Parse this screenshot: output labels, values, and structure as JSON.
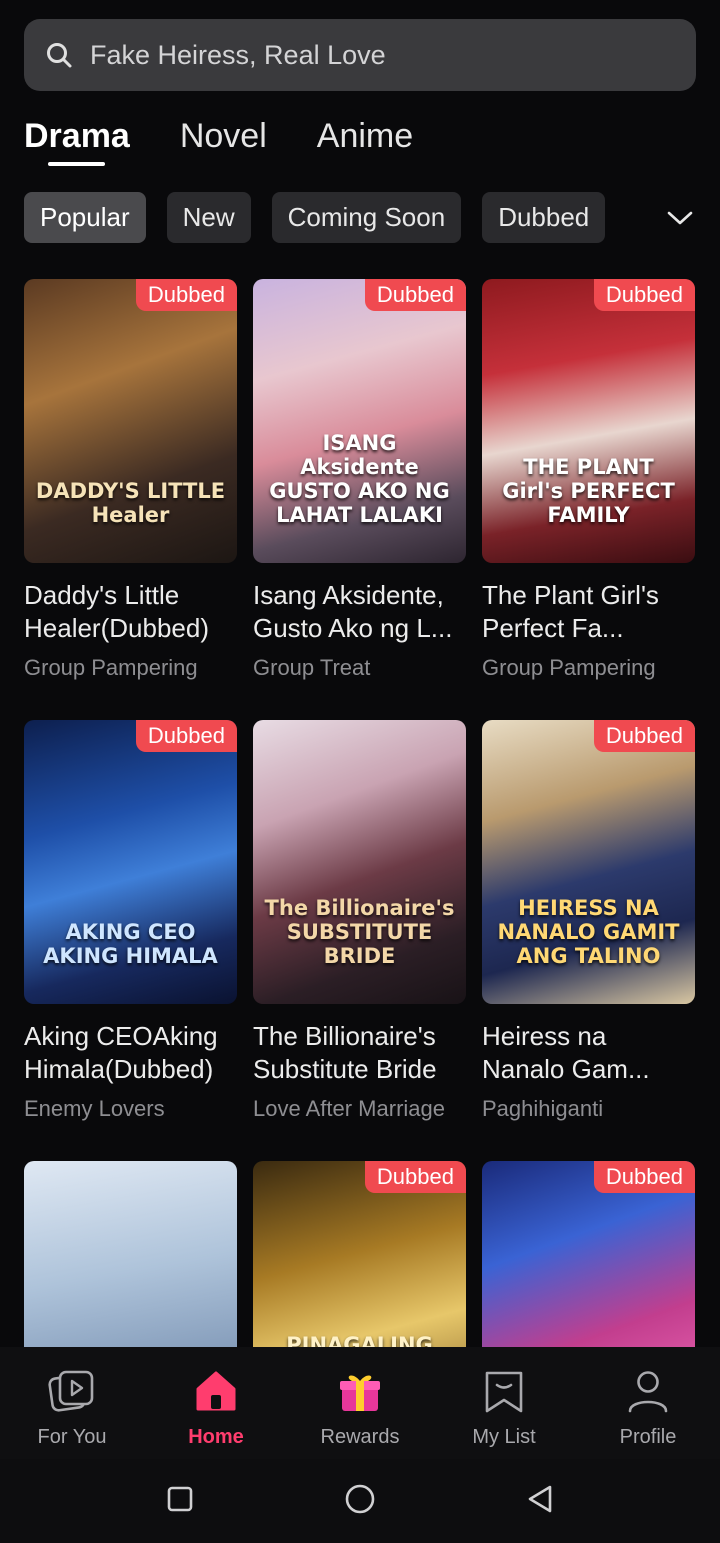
{
  "search": {
    "placeholder": "Fake Heiress, Real Love",
    "icon": "search-icon"
  },
  "tabs": [
    {
      "label": "Drama",
      "active": true
    },
    {
      "label": "Novel",
      "active": false
    },
    {
      "label": "Anime",
      "active": false
    }
  ],
  "chips": [
    {
      "label": "Popular",
      "active": true
    },
    {
      "label": "New",
      "active": false
    },
    {
      "label": "Coming Soon",
      "active": false
    },
    {
      "label": "Dubbed",
      "active": false
    }
  ],
  "chip_expand_icon": "chevron-down-icon",
  "cards": [
    {
      "title": "Daddy's Little Healer(Dubbed)",
      "genre": "Group Pampering",
      "badge": "Dubbed",
      "poster_text": "DADDY'S LITTLE Healer"
    },
    {
      "title": "Isang Aksidente, Gusto Ako ng L...",
      "genre": "Group Treat",
      "badge": "Dubbed",
      "poster_text": "ISANG Aksidente GUSTO AKO NG LAHAT LALAKI"
    },
    {
      "title": "The Plant Girl's Perfect Fa...",
      "genre": "Group Pampering",
      "badge": "Dubbed",
      "poster_text": "THE PLANT Girl's PERFECT FAMILY"
    },
    {
      "title": "Aking CEOAking Himala(Dubbed)",
      "genre": "Enemy Lovers",
      "badge": "Dubbed",
      "poster_text": "AKING CEO AKING HIMALA"
    },
    {
      "title": "The Billionaire's Substitute Bride",
      "genre": "Love After Marriage",
      "badge": "",
      "poster_text": "The Billionaire's SUBSTITUTE BRIDE"
    },
    {
      "title": "Heiress na Nanalo Gam...",
      "genre": "Paghihiganti",
      "badge": "Dubbed",
      "poster_text": "HEIRESS NA NANALO GAMIT ANG TALINO"
    },
    {
      "title": "",
      "genre": "",
      "badge": "",
      "poster_text": ""
    },
    {
      "title": "",
      "genre": "",
      "badge": "Dubbed",
      "poster_text": "PINAGALING MUNA AKING MORTAL ASAWA"
    },
    {
      "title": "",
      "genre": "",
      "badge": "Dubbed",
      "poster_text": ""
    }
  ],
  "nav": [
    {
      "label": "For You",
      "icon": "play-cards-icon",
      "active": false
    },
    {
      "label": "Home",
      "icon": "home-icon",
      "active": true
    },
    {
      "label": "Rewards",
      "icon": "gift-icon",
      "active": false
    },
    {
      "label": "My List",
      "icon": "bookmark-icon",
      "active": false
    },
    {
      "label": "Profile",
      "icon": "profile-icon",
      "active": false
    }
  ],
  "system_nav": [
    "recents-icon",
    "home-circle-icon",
    "back-icon"
  ],
  "colors": {
    "accent": "#ff3d6e",
    "badge": "#f04a50",
    "background": "#09090b"
  }
}
